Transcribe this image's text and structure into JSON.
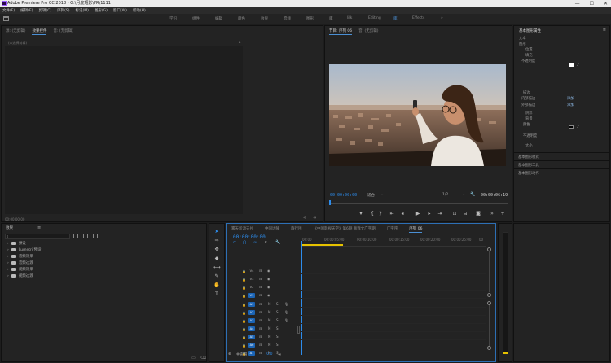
{
  "window": {
    "title": "Adobe Premiere Pro CC 2018 - G:\\月度短影\\PR\\1111",
    "controls": [
      "—",
      "☐",
      "✕"
    ]
  },
  "menu": [
    "文件(F)",
    "编辑(E)",
    "剪辑(C)",
    "序列(S)",
    "标记(M)",
    "图形(G)",
    "窗口(W)",
    "帮助(H)"
  ],
  "workspaces": [
    "学习",
    "组件",
    "编辑",
    "颜色",
    "效果",
    "音频",
    "图形",
    "库",
    "lilk",
    "Editing",
    "库",
    "Effects"
  ],
  "source_panel": {
    "tabs": [
      "源: (无剪辑)",
      "效果控件",
      "音: (无剪辑)"
    ],
    "no_clip_label": "(未选择剪辑)",
    "timecode": "00:00:00:00"
  },
  "program_monitor": {
    "tabs": [
      "节目: 序列 06",
      "音: (无剪辑)"
    ],
    "timecode_left": "00:00:00:00",
    "fit": "适合",
    "zoom": "1/2",
    "timecode_right": "00:00:06:19"
  },
  "essential": {
    "title": "基本图形属性",
    "items": [
      "文本",
      "图形",
      "位置",
      "填充",
      "不透明度",
      "内部描边",
      "外部描边",
      "阴影",
      "背景",
      "颜色",
      "不透明度",
      "大小",
      "描边",
      "添加",
      "添加"
    ],
    "sub_panels": [
      "基本图形模式",
      "基本图形工具",
      "基本图形动作"
    ]
  },
  "effects_panel": {
    "title": "效果",
    "items": [
      "预设",
      "Lumetri 预设",
      "音频效果",
      "音频过渡",
      "视频效果",
      "视频过渡"
    ]
  },
  "timeline": {
    "tabs": [
      "雾天新源天片",
      "中国边陲",
      "旅行团",
      "《中国影视天空》第6期 真我文广字期",
      "广字序",
      "序列 06"
    ],
    "timecode": "00:00:00:00",
    "ruler": [
      "00:00",
      "00:00:05:00",
      "00:00:10:00",
      "00:00:15:00",
      "00:00:20:00",
      "00:00:25:00",
      "00"
    ],
    "video_tracks": [
      "V4",
      "V3",
      "V2",
      "V1"
    ],
    "audio_tracks": [
      "A1",
      "A2",
      "A3",
      "A4",
      "A5",
      "A6",
      "A7"
    ],
    "master": "主声道",
    "master_value": "0.0"
  },
  "colors": {
    "accent": "#2d8ceb",
    "track_selected": "#1b64b5",
    "playhead_bar": "#e6c200"
  }
}
